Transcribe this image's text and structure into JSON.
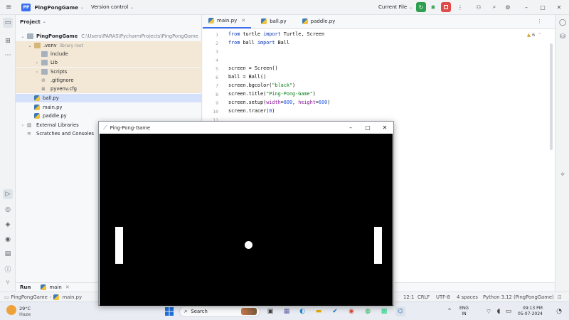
{
  "titlebar": {
    "project_badge": "PP",
    "project_name": "PingPongGame",
    "version_control": "Version control",
    "run_config": "Current File"
  },
  "project_panel": {
    "title": "Project",
    "root_name": "PingPongGame",
    "root_path": "C:\\Users\\PARAS\\PycharmProjects\\PingPongGame",
    "items": [
      {
        "label": ".venv",
        "hint": "library root"
      },
      {
        "label": "include"
      },
      {
        "label": "Lib"
      },
      {
        "label": "Scripts"
      },
      {
        "label": ".gitignore"
      },
      {
        "label": "pyvenv.cfg"
      },
      {
        "label": "ball.py"
      },
      {
        "label": "main.py"
      },
      {
        "label": "paddle.py"
      },
      {
        "label": "External Libraries"
      },
      {
        "label": "Scratches and Consoles"
      }
    ]
  },
  "tabs": [
    {
      "label": "main.py"
    },
    {
      "label": "ball.py"
    },
    {
      "label": "paddle.py"
    }
  ],
  "editor": {
    "warnings": "6",
    "line_numbers": [
      "1",
      "2",
      "3",
      "4",
      "5",
      "6",
      "7",
      "8",
      "9",
      "10",
      "11"
    ],
    "lines": {
      "l1_kw1": "from",
      "l1_mid": " turtle ",
      "l1_kw2": "import",
      "l1_end": " Turtle, Screen",
      "l2_kw1": "from",
      "l2_mid": " ball ",
      "l2_kw2": "import",
      "l2_end": " Ball",
      "l5": "screen = Screen()",
      "l6": "ball = Ball()",
      "l7_a": "screen.bgcolor(",
      "l7_s": "\"black\"",
      "l7_b": ")",
      "l8_a": "screen.title(",
      "l8_s": "\"Ping-Pong-Game\"",
      "l8_b": ")",
      "l9_a": "screen.setup(",
      "l9_p1": "width",
      "l9_e1": "=",
      "l9_n1": "800",
      "l9_c": ", ",
      "l9_p2": "height",
      "l9_e2": "=",
      "l9_n2": "600",
      "l9_b": ")",
      "l10_a": "screen.tracer(",
      "l10_n": "0",
      "l10_b": ")"
    }
  },
  "turtle_window": {
    "title": "Ping-Pong-Game"
  },
  "runbar": {
    "label": "Run",
    "config": "main"
  },
  "statusbar": {
    "breadcrumb_project": "PingPongGame",
    "breadcrumb_file": "main.py",
    "position": "12:1",
    "line_sep": "CRLF",
    "encoding": "UTF-8",
    "indent": "4 spaces",
    "interpreter": "Python 3.12 (PingPongGame)"
  },
  "taskbar": {
    "weather_temp": "29°C",
    "weather_desc": "Haze",
    "search_label": "Search",
    "lang_top": "ENG",
    "lang_bottom": "IN",
    "time": "09:13 PM",
    "date": "05-07-2024"
  },
  "colors": {
    "accent": "#3b6ff2",
    "run_green": "#2e9e4f",
    "stop_red": "#e04a4a",
    "canvas": "#000000"
  }
}
